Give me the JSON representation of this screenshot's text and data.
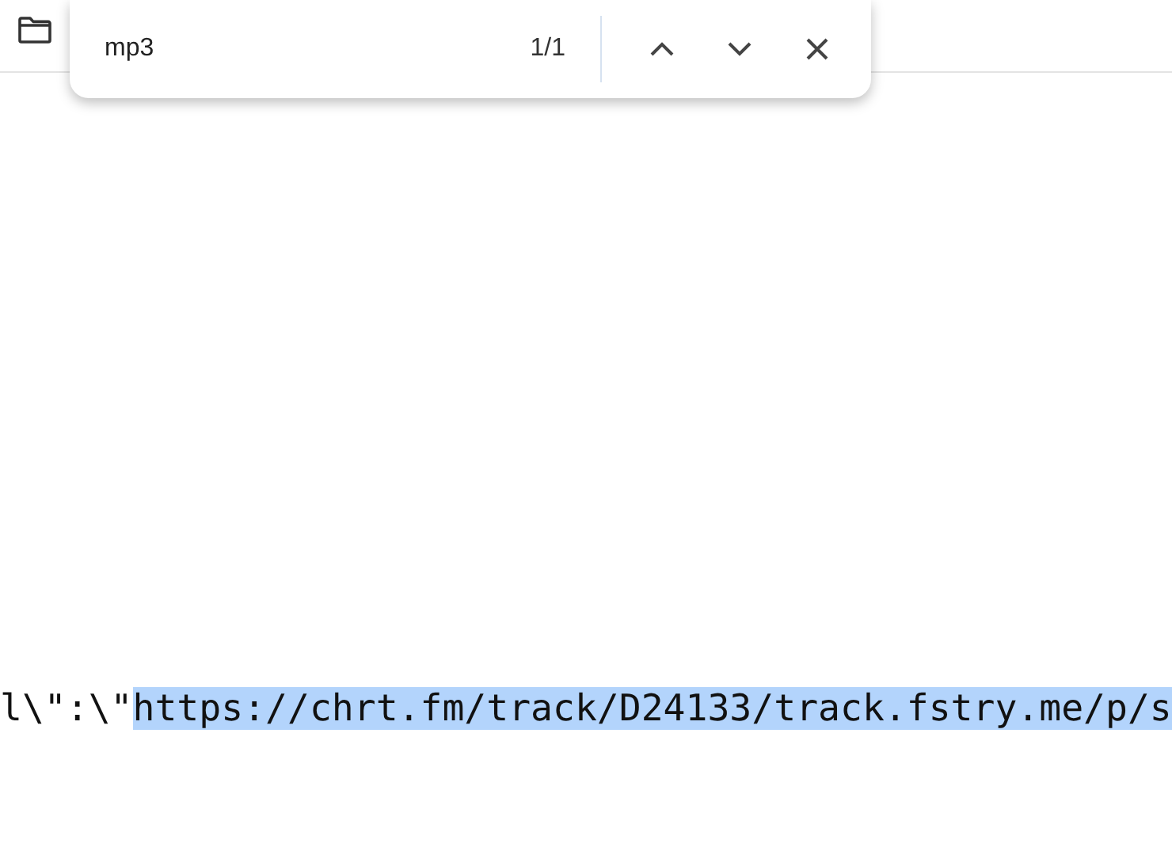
{
  "find_bar": {
    "query": "mp3",
    "count": "1/1"
  },
  "content": {
    "segments": [
      {
        "text": "l\\\":\\\"",
        "highlighted": false
      },
      {
        "text": "https://chrt.fm/track/D24133/track.fstry.me/p/s",
        "highlighted": true
      }
    ]
  }
}
